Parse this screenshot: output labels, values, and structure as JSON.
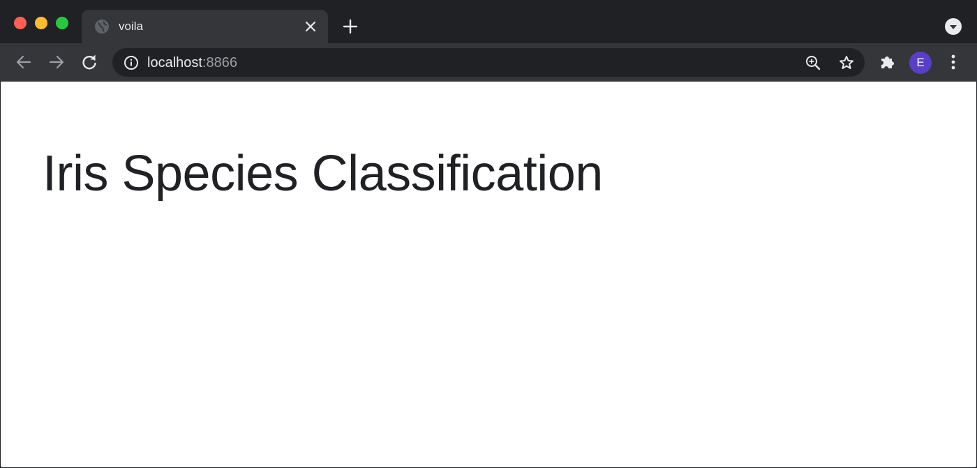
{
  "browser": {
    "tab": {
      "title": "voila"
    },
    "omnibox": {
      "host": "localhost",
      "port": ":8866"
    },
    "profile": {
      "initial": "E"
    },
    "colors": {
      "frame": "#202124",
      "toolbar": "#35363a",
      "avatar": "#5a3ec8"
    },
    "icons": {
      "tab_favicon": "globe-icon",
      "tab_close": "close-icon",
      "new_tab": "plus-icon",
      "tab_search": "chevron-down-icon",
      "back": "arrow-left-icon",
      "forward": "arrow-right-icon",
      "reload": "reload-icon",
      "site_info": "info-icon",
      "zoom": "zoom-in-icon",
      "bookmark": "star-icon",
      "extensions": "puzzle-icon",
      "menu": "kebab-menu-icon"
    }
  },
  "page": {
    "title": "Iris Species Classification"
  }
}
